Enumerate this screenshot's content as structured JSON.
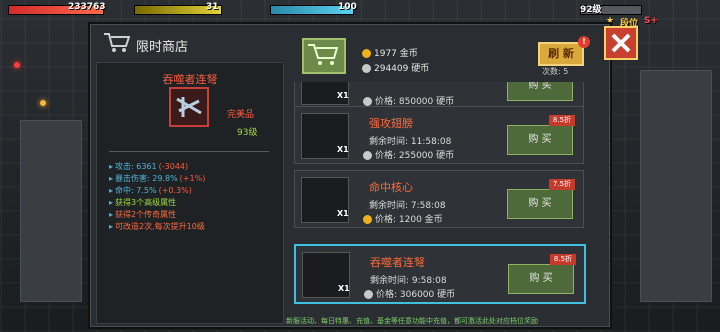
{
  "hud": {
    "health_value": "233763",
    "energy_value": "31",
    "shield_value": "100",
    "level_label": "92级",
    "rank_label": "段位",
    "rank_value": "S+"
  },
  "shop": {
    "title": "限时商店",
    "gold_amount": "1977 金币",
    "hard_amount": "294409 硬币",
    "refresh_label": "刷 新",
    "refresh_badge": "!",
    "count_label": "次数: 5"
  },
  "detail": {
    "name": "吞噬者连弩",
    "quality": "完美品",
    "level": "93级",
    "attrs": [
      {
        "text": "攻击: 6361",
        "extra": "(-3044)",
        "color": "#4fb3d9"
      },
      {
        "text": "暴击伤害: 29.8%",
        "extra": "(+1%)",
        "color": "#4fb3d9"
      },
      {
        "text": "命中: 7.5%",
        "extra": "(+0.3%)",
        "color": "#4fb3d9"
      },
      {
        "text": "获得3个高级属性",
        "extra": "",
        "color": "#9fdc3a"
      },
      {
        "text": "获得2个传奇属性",
        "extra": "",
        "color": "#ff6a3c"
      },
      {
        "text": "可改造2次,每次提升10级",
        "extra": "",
        "color": "#ff6a3c"
      }
    ]
  },
  "items": [
    {
      "name": "",
      "timer": "",
      "price": "价格: 850000 硬币",
      "discount": "",
      "buy": "购 买",
      "x": "X1",
      "currency": "silver"
    },
    {
      "name": "强攻翅膀",
      "timer": "剩余时间: 11:58:08",
      "price": "价格: 255000 硬币",
      "discount": "8.5折",
      "buy": "购 买",
      "x": "X1",
      "currency": "silver"
    },
    {
      "name": "命中核心",
      "timer": "剩余时间: 7:58:08",
      "price": "价格: 1200 金币",
      "discount": "7.5折",
      "buy": "购 买",
      "x": "X1",
      "currency": "gold"
    },
    {
      "name": "吞噬者连弩",
      "timer": "剩余时间: 9:58:08",
      "price": "价格: 306000 硬币",
      "discount": "8.5折",
      "buy": "购 买",
      "x": "X1",
      "currency": "silver"
    }
  ],
  "footer": {
    "note": "新服活动、每日特惠、充值、基金等任意功能中充值，都可激活此处对应档位奖励"
  }
}
